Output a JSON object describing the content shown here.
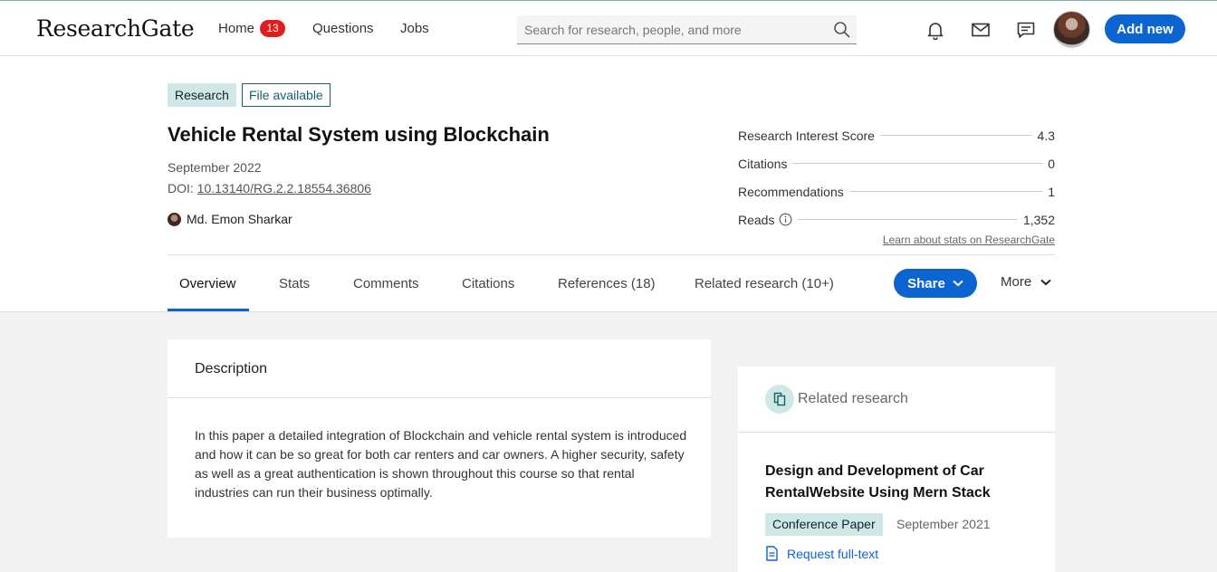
{
  "nav": {
    "logo": "ResearchGate",
    "home": "Home",
    "home_badge": "13",
    "questions": "Questions",
    "jobs": "Jobs",
    "search_placeholder": "Search for research, people, and more",
    "add_new": "Add new"
  },
  "publication": {
    "tag_research": "Research",
    "tag_file": "File available",
    "title": "Vehicle Rental System using Blockchain",
    "date": "September 2022",
    "doi_label": "DOI: ",
    "doi": "10.13140/RG.2.2.18554.36806",
    "author": "Md. Emon Sharkar"
  },
  "stats": {
    "rows": [
      {
        "label": "Research Interest Score",
        "value": "4.3"
      },
      {
        "label": "Citations",
        "value": "0"
      },
      {
        "label": "Recommendations",
        "value": "1"
      },
      {
        "label": "Reads",
        "value": "1,352"
      }
    ],
    "learn_link": "Learn about stats on ResearchGate"
  },
  "tabs": {
    "overview": "Overview",
    "stats": "Stats",
    "comments": "Comments",
    "citations": "Citations",
    "references": "References (18)",
    "related": "Related research (10+)",
    "share": "Share",
    "more": "More"
  },
  "description": {
    "heading": "Description",
    "text": "In this paper a detailed integration of Blockchain and vehicle rental system is introduced and how it can be so great for both car renters and car owners. A higher security, safety as well as a great authentication is shown throughout this course so that rental industries can run their business optimally."
  },
  "related": {
    "heading": "Related research",
    "item_title": "Design and Development of Car RentalWebsite Using Mern Stack",
    "item_type": "Conference Paper",
    "item_date": "September 2021",
    "request": "Request full-text"
  },
  "colors": {
    "accent": "#0b64d0",
    "badge": "#e01e1e",
    "tag_bg": "#cfe8e6",
    "file_border": "#16606a"
  }
}
